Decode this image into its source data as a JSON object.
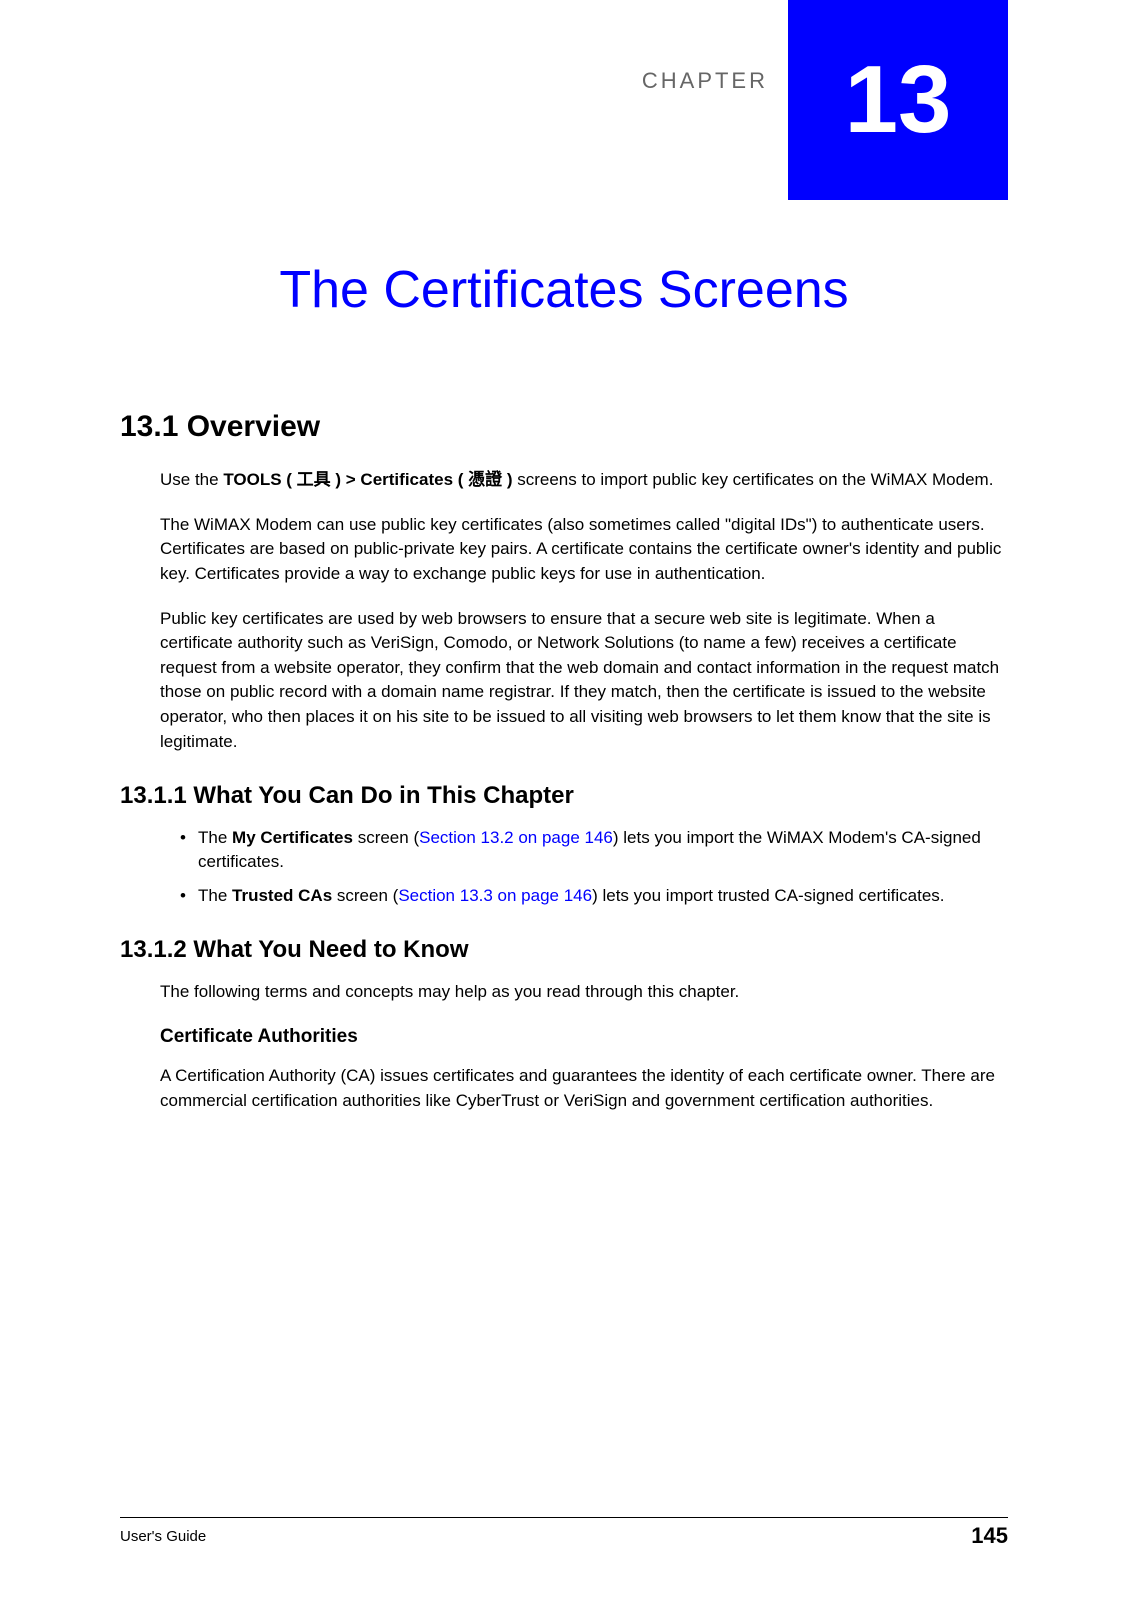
{
  "chapter": {
    "label": "CHAPTER",
    "number": "13",
    "title": "The Certificates Screens"
  },
  "section_13_1": {
    "heading": "13.1  Overview",
    "p1_pre": "Use the ",
    "p1_bold": "TOOLS ( 工具 ) > Certificates ( 憑證 )",
    "p1_post": " screens to import public key certificates on the WiMAX Modem.",
    "p2": "The WiMAX Modem can use public key certificates (also sometimes called \"digital IDs\") to authenticate users. Certificates are based on public-private key pairs. A certificate contains the certificate owner's identity and public key. Certificates provide a way to exchange public keys for use in authentication.",
    "p3": "Public key certificates are used by web browsers to ensure that a secure web site is legitimate. When a certificate authority such as VeriSign, Comodo, or Network Solutions (to name a few) receives a certificate request from a website operator, they confirm that the web domain and contact information in the request match those on public record with a domain name registrar. If they match, then the certificate is issued to the website operator, who then places it on his site to be issued to all visiting web browsers to let them know that the site is legitimate."
  },
  "section_13_1_1": {
    "heading": "13.1.1  What You Can Do in This Chapter",
    "bullet1_pre": "The ",
    "bullet1_bold": "My Certificates",
    "bullet1_mid": " screen (",
    "bullet1_link": "Section 13.2 on page 146",
    "bullet1_post": ") lets you import the WiMAX Modem's CA-signed certificates.",
    "bullet2_pre": "The ",
    "bullet2_bold": "Trusted CAs",
    "bullet2_mid": " screen (",
    "bullet2_link": "Section 13.3 on page 146",
    "bullet2_post": ") lets you import trusted CA-signed certificates."
  },
  "section_13_1_2": {
    "heading": "13.1.2  What You Need to Know",
    "p1": "The following terms and concepts may help as you read through this chapter.",
    "subheading": "Certificate Authorities",
    "p2": "A Certification Authority (CA) issues certificates and guarantees the identity of each certificate owner. There are commercial certification authorities like CyberTrust or VeriSign and government certification authorities."
  },
  "footer": {
    "left": "User's Guide",
    "right": "145"
  }
}
